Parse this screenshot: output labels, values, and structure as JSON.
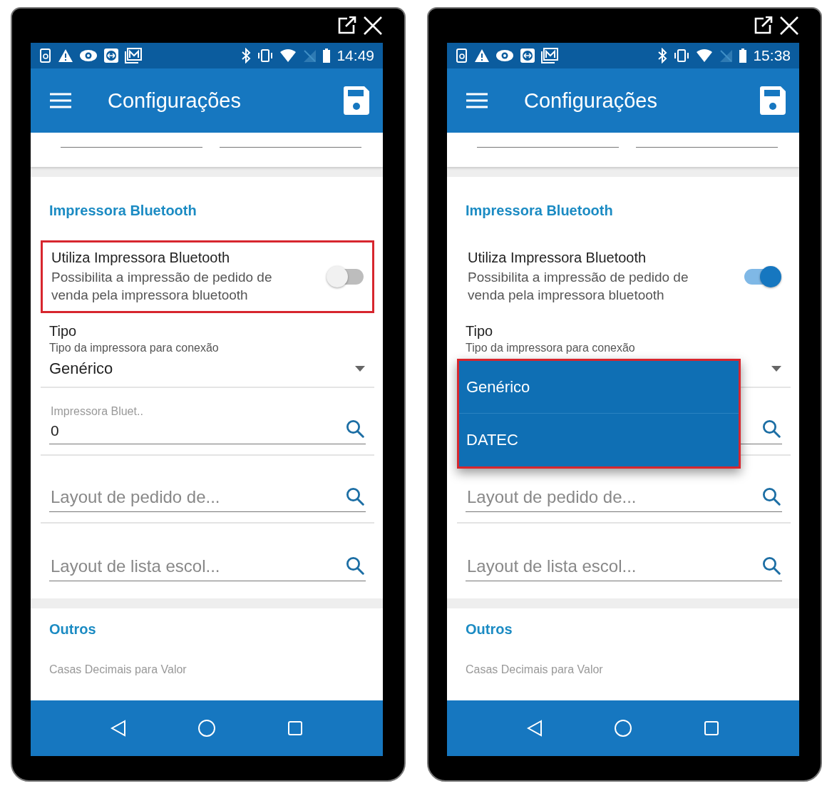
{
  "phones": [
    {
      "status_bar": {
        "time": "14:49"
      },
      "app_bar": {
        "title": "Configurações"
      },
      "bluetooth_section": {
        "heading": "Impressora Bluetooth",
        "toggle": {
          "title": "Utiliza Impressora Bluetooth",
          "description": "Possibilita a impressão de pedido de venda pela impressora bluetooth",
          "on": false,
          "highlighted": true
        },
        "type_select": {
          "label": "Tipo",
          "hint": "Tipo da impressora para conexão",
          "value": "Genérico",
          "expanded": false,
          "highlighted": false
        },
        "lookup_fields": [
          {
            "kind": "lookup",
            "label": "Impressora Bluet..",
            "value": "0"
          },
          {
            "kind": "lookup",
            "placeholder": "Layout de pedido de..."
          },
          {
            "kind": "lookup",
            "placeholder": "Layout de lista escol..."
          }
        ]
      },
      "other_section": {
        "heading": "Outros",
        "field_label": "Casas Decimais para Valor"
      }
    },
    {
      "status_bar": {
        "time": "15:38"
      },
      "app_bar": {
        "title": "Configurações"
      },
      "bluetooth_section": {
        "heading": "Impressora Bluetooth",
        "toggle": {
          "title": "Utiliza Impressora Bluetooth",
          "description": "Possibilita a impressão de pedido de venda pela impressora bluetooth",
          "on": true,
          "highlighted": false
        },
        "type_select": {
          "label": "Tipo",
          "hint": "Tipo da impressora para conexão",
          "expanded": true,
          "highlighted": true,
          "options": [
            {
              "label": "Genérico"
            },
            {
              "label": "DATEC"
            }
          ]
        },
        "lookup_fields": [
          {
            "kind": "lookup"
          },
          {
            "kind": "lookup",
            "placeholder": "Layout de pedido de..."
          },
          {
            "kind": "lookup",
            "placeholder": "Layout de lista escol..."
          }
        ]
      },
      "other_section": {
        "heading": "Outros",
        "field_label": "Casas Decimais para Valor"
      }
    }
  ]
}
